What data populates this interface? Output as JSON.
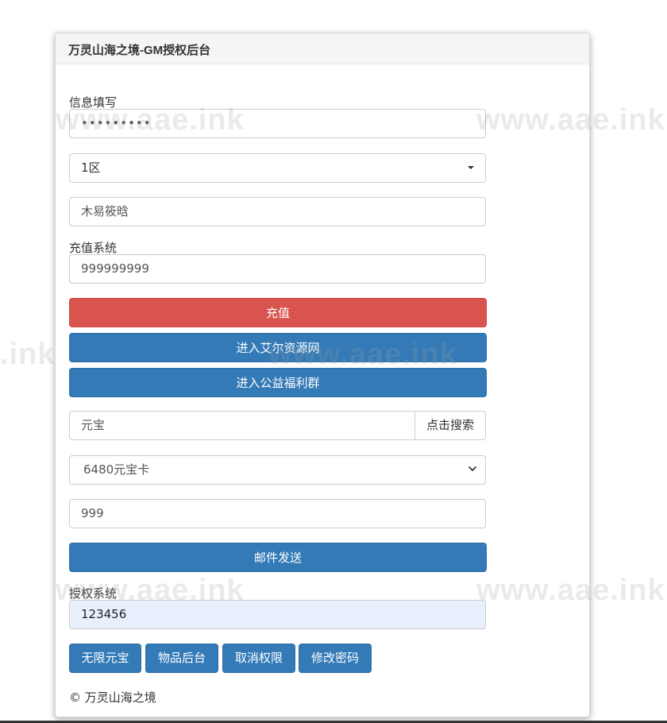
{
  "panel": {
    "title": "万灵山海之境-GM授权后台"
  },
  "info": {
    "label": "信息填写",
    "password_value": "•••••••••",
    "server_value": "1区",
    "role_value": "木易筱晗"
  },
  "recharge": {
    "label": "充值系统",
    "amount_value": "999999999",
    "recharge_button": "充值",
    "site_button": "进入艾尔资源网",
    "group_button": "进入公益福利群"
  },
  "mail": {
    "search_value": "元宝",
    "search_button": "点击搜索",
    "item_select_value": "6480元宝卡",
    "quantity_value": "999",
    "send_button": "邮件发送"
  },
  "auth": {
    "label": "授权系统",
    "code_value": "123456",
    "buttons": [
      "无限元宝",
      "物品后台",
      "取消权限",
      "修改密码"
    ]
  },
  "footer": {
    "text": "© 万灵山海之境"
  },
  "watermark": {
    "text": "www.aae.ink",
    "partial": ".ink"
  },
  "colors": {
    "danger": "#d9534f",
    "primary": "#337ab7",
    "autofill": "#e8f0fe"
  }
}
